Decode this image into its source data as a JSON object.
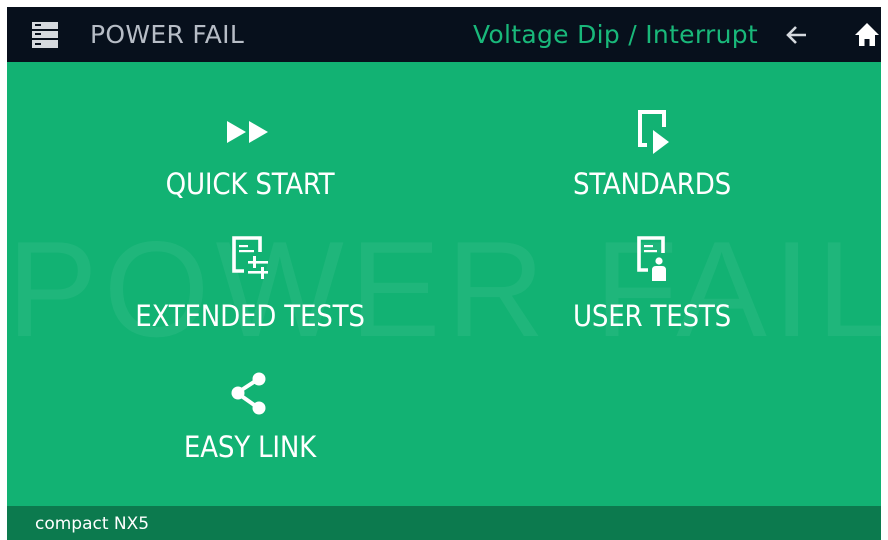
{
  "header": {
    "app_title": "POWER FAIL",
    "mode_title": "Voltage Dip / Interrupt",
    "icons": [
      "menu-icon",
      "back-arrow-icon",
      "home-icon"
    ]
  },
  "watermark": "POWER FAIL",
  "menu": {
    "items": [
      {
        "label": "QUICK START",
        "icon": "fast-forward-icon"
      },
      {
        "label": "STANDARDS",
        "icon": "document-play-icon"
      },
      {
        "label": "EXTENDED TESTS",
        "icon": "document-sliders-icon"
      },
      {
        "label": "USER TESTS",
        "icon": "document-user-icon"
      },
      {
        "label": "EASY LINK",
        "icon": "share-icon"
      }
    ]
  },
  "footer": {
    "device_name": "compact NX5"
  },
  "colors": {
    "titlebar": "#07101c",
    "background": "#12b273",
    "footer": "#0c7a4e",
    "accent": "#19b87a",
    "title_gray": "#b7bdc6"
  }
}
